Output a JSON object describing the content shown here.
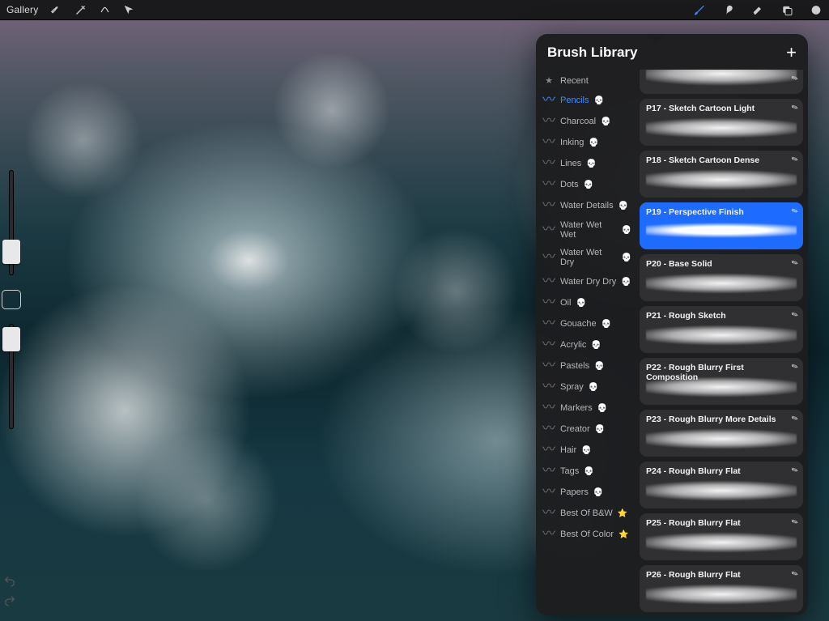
{
  "topbar": {
    "gallery_label": "Gallery"
  },
  "panel": {
    "title": "Brush Library"
  },
  "categories": [
    {
      "label": "Recent",
      "icon": "star",
      "active": false
    },
    {
      "label": "Pencils",
      "icon": "stroke",
      "active": true,
      "badge": "skull"
    },
    {
      "label": "Charcoal",
      "icon": "stroke",
      "active": false,
      "badge": "skull"
    },
    {
      "label": "Inking",
      "icon": "stroke",
      "active": false,
      "badge": "skull"
    },
    {
      "label": "Lines",
      "icon": "stroke",
      "active": false,
      "badge": "skull"
    },
    {
      "label": "Dots",
      "icon": "stroke",
      "active": false,
      "badge": "skull"
    },
    {
      "label": "Water Details",
      "icon": "stroke",
      "active": false,
      "badge": "skull"
    },
    {
      "label": "Water Wet Wet",
      "icon": "stroke",
      "active": false,
      "badge": "skull"
    },
    {
      "label": "Water Wet Dry",
      "icon": "stroke",
      "active": false,
      "badge": "skull"
    },
    {
      "label": "Water Dry Dry",
      "icon": "stroke",
      "active": false,
      "badge": "skull"
    },
    {
      "label": "Oil",
      "icon": "stroke",
      "active": false,
      "badge": "skull"
    },
    {
      "label": "Gouache",
      "icon": "stroke",
      "active": false,
      "badge": "skull"
    },
    {
      "label": "Acrylic",
      "icon": "stroke",
      "active": false,
      "badge": "skull"
    },
    {
      "label": "Pastels",
      "icon": "stroke",
      "active": false,
      "badge": "skull"
    },
    {
      "label": "Spray",
      "icon": "stroke",
      "active": false,
      "badge": "skull"
    },
    {
      "label": "Markers",
      "icon": "stroke",
      "active": false,
      "badge": "skull"
    },
    {
      "label": "Creator",
      "icon": "stroke",
      "active": false,
      "badge": "skull"
    },
    {
      "label": "Hair",
      "icon": "stroke",
      "active": false,
      "badge": "skull"
    },
    {
      "label": "Tags",
      "icon": "stroke",
      "active": false,
      "badge": "skull"
    },
    {
      "label": "Papers",
      "icon": "stroke",
      "active": false,
      "badge": "skull"
    },
    {
      "label": "Best Of B&W",
      "icon": "stroke",
      "active": false,
      "badge": "yellowstar"
    },
    {
      "label": "Best Of Color",
      "icon": "stroke",
      "active": false,
      "badge": "yellowstar"
    }
  ],
  "brushes": [
    {
      "name": "",
      "selected": false,
      "first": true
    },
    {
      "name": "P17 - Sketch  Cartoon Light",
      "selected": false
    },
    {
      "name": "P18 - Sketch Cartoon Dense",
      "selected": false
    },
    {
      "name": "P19 - Perspective Finish",
      "selected": true
    },
    {
      "name": "P20 - Base Solid",
      "selected": false
    },
    {
      "name": "P21 - Rough Sketch",
      "selected": false
    },
    {
      "name": "P22 - Rough Blurry First Composition",
      "selected": false
    },
    {
      "name": "P23 - Rough Blurry More Details",
      "selected": false
    },
    {
      "name": "P24 - Rough Blurry Flat",
      "selected": false
    },
    {
      "name": "P25 - Rough Blurry Flat",
      "selected": false
    },
    {
      "name": "P26 - Rough Blurry Flat",
      "selected": false
    }
  ],
  "colors": {
    "accent": "#1e6bff",
    "active_icon": "#3d8bff"
  }
}
